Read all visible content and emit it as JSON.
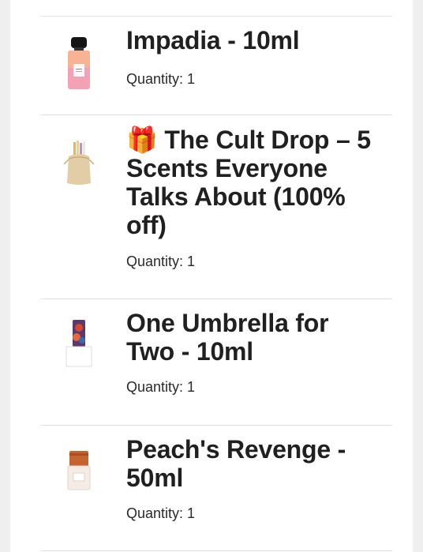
{
  "order_items": [
    {
      "title": "Impadia - 10ml",
      "quantity_label": "Quantity: 1",
      "image": "pink-perfume-bottle"
    },
    {
      "title": "🎁 The Cult Drop – 5 Scents Everyone Talks About (100% off)",
      "quantity_label": "Quantity: 1",
      "image": "sample-vials-in-pouch"
    },
    {
      "title": "One Umbrella for Two - 10ml",
      "quantity_label": "Quantity: 1",
      "image": "patterned-perfume-bottle"
    },
    {
      "title": "Peach's Revenge - 50ml",
      "quantity_label": "Quantity: 1",
      "image": "orange-cap-perfume-bottle"
    }
  ]
}
